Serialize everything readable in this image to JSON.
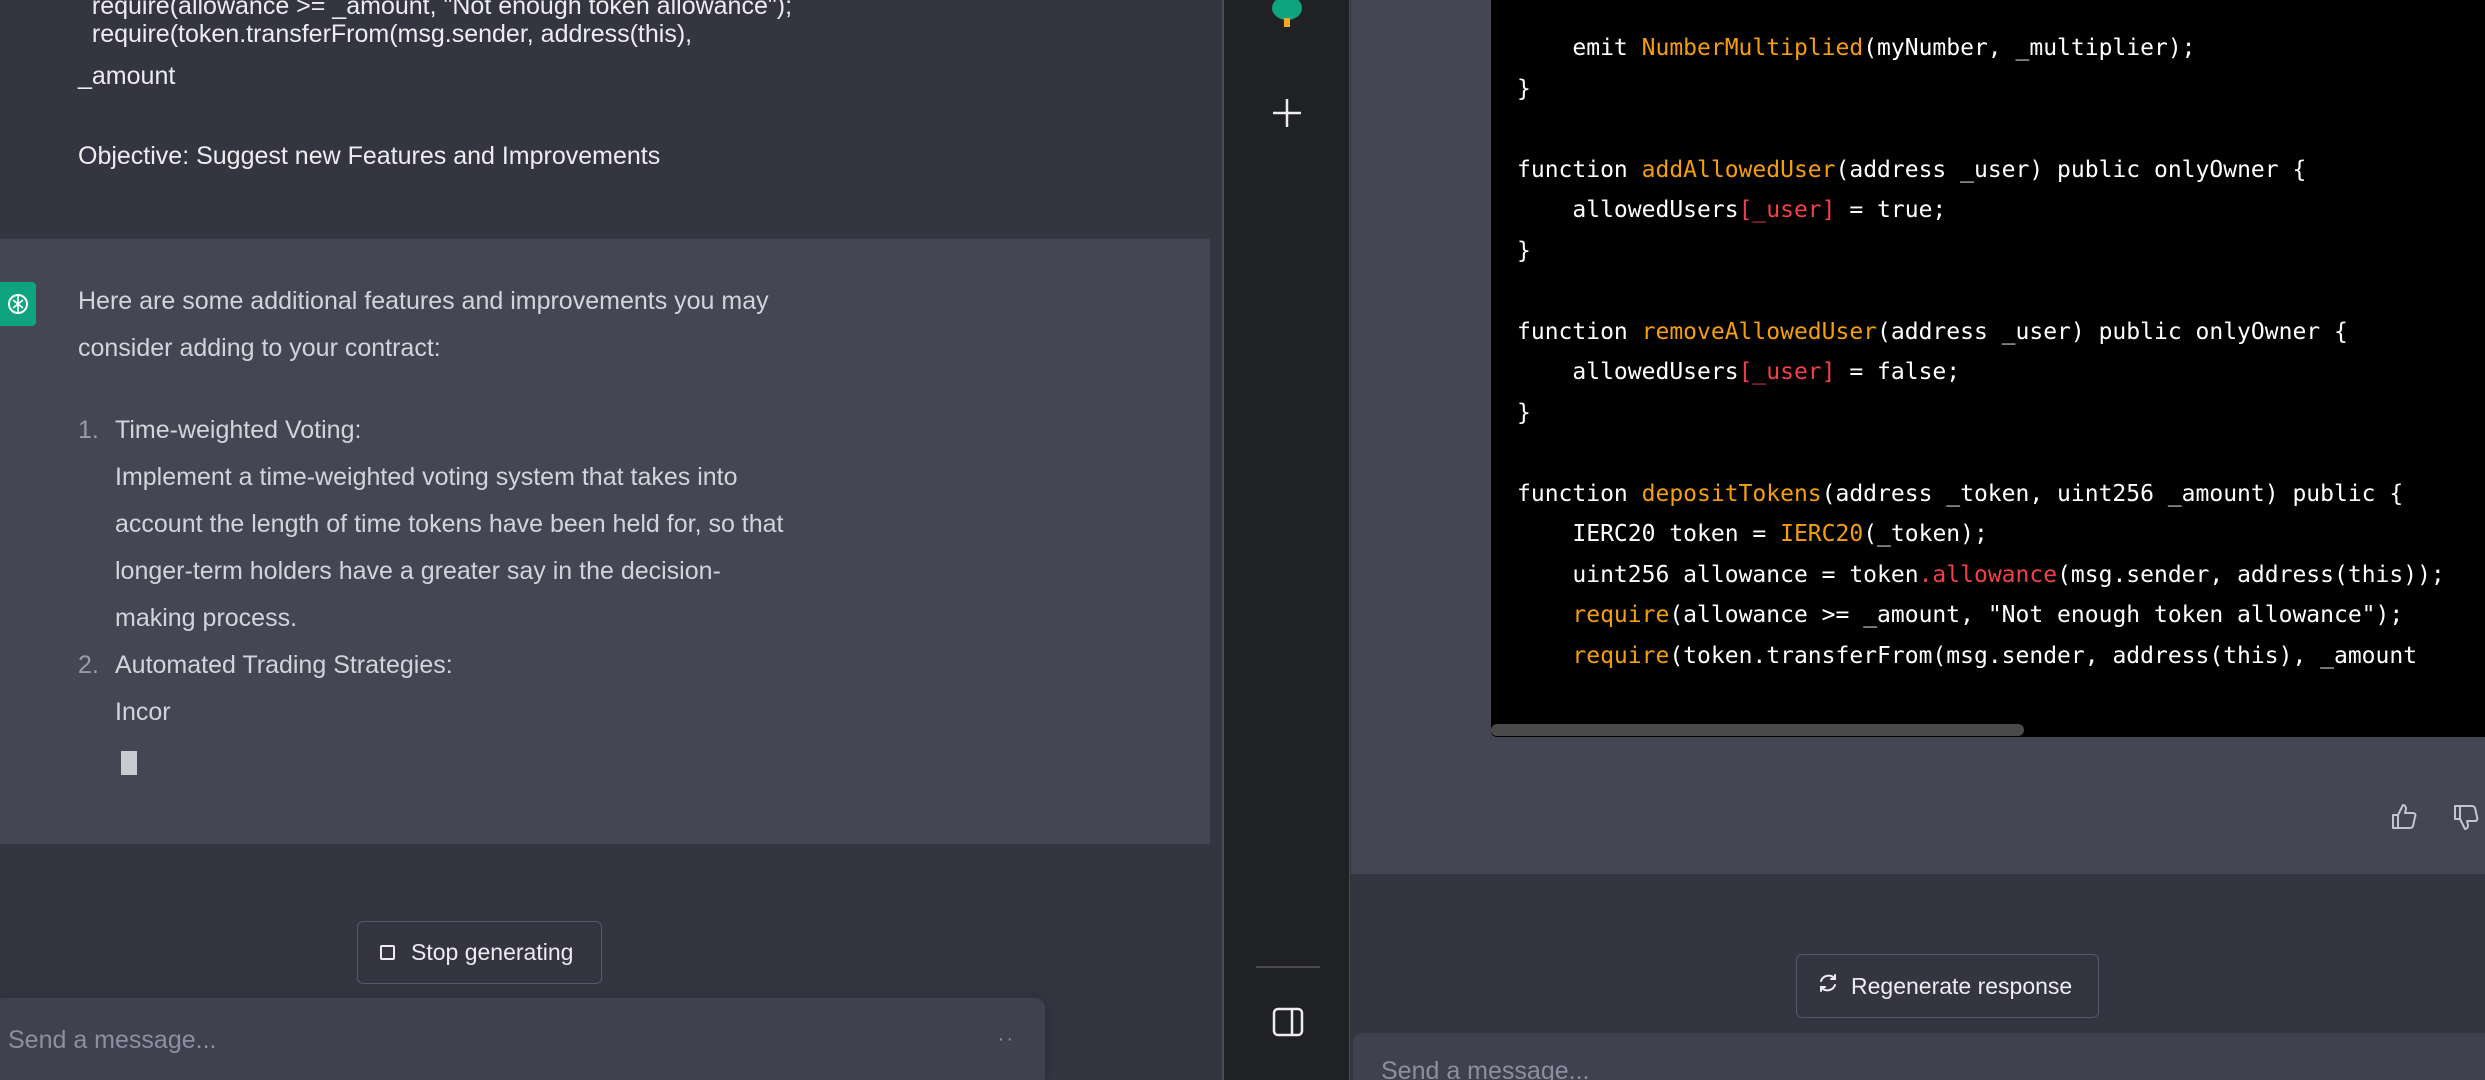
{
  "left_chat": {
    "user_message_lines": [
      "  require(allowance >= _amount, \"Not enough token allowance\");",
      "  require(token.transferFrom(msg.sender, address(this),",
      "_amount",
      "Objective: Suggest new Features and Improvements"
    ],
    "assistant": {
      "intro_line1": "Here are some additional features and improvements you may",
      "intro_line2": "consider adding to your contract:",
      "items": [
        {
          "num": "1.",
          "lines": [
            "Time-weighted Voting:",
            "Implement a time-weighted voting system that takes into",
            "account the length of time tokens have been held for, so that",
            "longer-term holders have a greater say in the decision-",
            "making process."
          ]
        },
        {
          "num": "2.",
          "lines": [
            "Automated Trading Strategies:",
            "Incor"
          ]
        }
      ]
    },
    "stop_button_label": "Stop generating",
    "input_placeholder": "Send a message..."
  },
  "sidebar": {
    "icons": [
      "tree-icon",
      "plus-icon",
      "panel-toggle-icon"
    ]
  },
  "right_chat": {
    "code_lines": [
      [
        {
          "t": "    emit "
        },
        {
          "t": "NumberMultiplied",
          "c": "fn"
        },
        {
          "t": "(myNumber, _multiplier);"
        }
      ],
      [
        {
          "t": "}"
        }
      ],
      [
        {
          "t": ""
        }
      ],
      [
        {
          "t": "function "
        },
        {
          "t": "addAllowedUser",
          "c": "fn"
        },
        {
          "t": "(address _user) public onlyOwner {"
        }
      ],
      [
        {
          "t": "    allowedUsers"
        },
        {
          "t": "[_user]",
          "c": "kw"
        },
        {
          "t": " = true;"
        }
      ],
      [
        {
          "t": "}"
        }
      ],
      [
        {
          "t": ""
        }
      ],
      [
        {
          "t": "function "
        },
        {
          "t": "removeAllowedUser",
          "c": "fn"
        },
        {
          "t": "(address _user) public onlyOwner {"
        }
      ],
      [
        {
          "t": "    allowedUsers"
        },
        {
          "t": "[_user]",
          "c": "kw"
        },
        {
          "t": " = false;"
        }
      ],
      [
        {
          "t": "}"
        }
      ],
      [
        {
          "t": ""
        }
      ],
      [
        {
          "t": "function "
        },
        {
          "t": "depositTokens",
          "c": "fn"
        },
        {
          "t": "(address _token, uint256 _amount) public {"
        }
      ],
      [
        {
          "t": "    IERC20 token = "
        },
        {
          "t": "IERC20",
          "c": "fn"
        },
        {
          "t": "(_token);"
        }
      ],
      [
        {
          "t": "    uint256 allowance = token"
        },
        {
          "t": ".allowance",
          "c": "kw"
        },
        {
          "t": "(msg.sender, address(this));"
        }
      ],
      [
        {
          "t": "    "
        },
        {
          "t": "require",
          "c": "fn"
        },
        {
          "t": "(allowance >= _amount, \"Not enough token allowance\");"
        }
      ],
      [
        {
          "t": "    "
        },
        {
          "t": "require",
          "c": "fn"
        },
        {
          "t": "(token.transferFrom(msg.sender, address(this), _amount"
        }
      ]
    ],
    "regenerate_label": "Regenerate response",
    "input_placeholder": "Send a message..."
  },
  "colors": {
    "background": "#343541",
    "assistant_bg": "#444654",
    "sidebar_bg": "#202123",
    "code_function": "#f59e0b",
    "code_keyword": "#ef4146",
    "brand": "#10a37f"
  }
}
